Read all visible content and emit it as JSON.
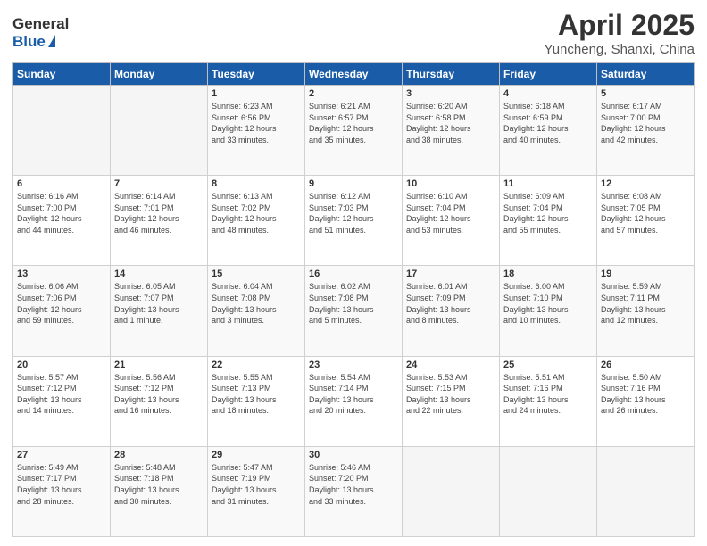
{
  "header": {
    "logo_general": "General",
    "logo_blue": "Blue",
    "title": "April 2025",
    "subtitle": "Yuncheng, Shanxi, China"
  },
  "calendar": {
    "days_of_week": [
      "Sunday",
      "Monday",
      "Tuesday",
      "Wednesday",
      "Thursday",
      "Friday",
      "Saturday"
    ],
    "weeks": [
      [
        {
          "day": "",
          "info": ""
        },
        {
          "day": "",
          "info": ""
        },
        {
          "day": "1",
          "info": "Sunrise: 6:23 AM\nSunset: 6:56 PM\nDaylight: 12 hours\nand 33 minutes."
        },
        {
          "day": "2",
          "info": "Sunrise: 6:21 AM\nSunset: 6:57 PM\nDaylight: 12 hours\nand 35 minutes."
        },
        {
          "day": "3",
          "info": "Sunrise: 6:20 AM\nSunset: 6:58 PM\nDaylight: 12 hours\nand 38 minutes."
        },
        {
          "day": "4",
          "info": "Sunrise: 6:18 AM\nSunset: 6:59 PM\nDaylight: 12 hours\nand 40 minutes."
        },
        {
          "day": "5",
          "info": "Sunrise: 6:17 AM\nSunset: 7:00 PM\nDaylight: 12 hours\nand 42 minutes."
        }
      ],
      [
        {
          "day": "6",
          "info": "Sunrise: 6:16 AM\nSunset: 7:00 PM\nDaylight: 12 hours\nand 44 minutes."
        },
        {
          "day": "7",
          "info": "Sunrise: 6:14 AM\nSunset: 7:01 PM\nDaylight: 12 hours\nand 46 minutes."
        },
        {
          "day": "8",
          "info": "Sunrise: 6:13 AM\nSunset: 7:02 PM\nDaylight: 12 hours\nand 48 minutes."
        },
        {
          "day": "9",
          "info": "Sunrise: 6:12 AM\nSunset: 7:03 PM\nDaylight: 12 hours\nand 51 minutes."
        },
        {
          "day": "10",
          "info": "Sunrise: 6:10 AM\nSunset: 7:04 PM\nDaylight: 12 hours\nand 53 minutes."
        },
        {
          "day": "11",
          "info": "Sunrise: 6:09 AM\nSunset: 7:04 PM\nDaylight: 12 hours\nand 55 minutes."
        },
        {
          "day": "12",
          "info": "Sunrise: 6:08 AM\nSunset: 7:05 PM\nDaylight: 12 hours\nand 57 minutes."
        }
      ],
      [
        {
          "day": "13",
          "info": "Sunrise: 6:06 AM\nSunset: 7:06 PM\nDaylight: 12 hours\nand 59 minutes."
        },
        {
          "day": "14",
          "info": "Sunrise: 6:05 AM\nSunset: 7:07 PM\nDaylight: 13 hours\nand 1 minute."
        },
        {
          "day": "15",
          "info": "Sunrise: 6:04 AM\nSunset: 7:08 PM\nDaylight: 13 hours\nand 3 minutes."
        },
        {
          "day": "16",
          "info": "Sunrise: 6:02 AM\nSunset: 7:08 PM\nDaylight: 13 hours\nand 5 minutes."
        },
        {
          "day": "17",
          "info": "Sunrise: 6:01 AM\nSunset: 7:09 PM\nDaylight: 13 hours\nand 8 minutes."
        },
        {
          "day": "18",
          "info": "Sunrise: 6:00 AM\nSunset: 7:10 PM\nDaylight: 13 hours\nand 10 minutes."
        },
        {
          "day": "19",
          "info": "Sunrise: 5:59 AM\nSunset: 7:11 PM\nDaylight: 13 hours\nand 12 minutes."
        }
      ],
      [
        {
          "day": "20",
          "info": "Sunrise: 5:57 AM\nSunset: 7:12 PM\nDaylight: 13 hours\nand 14 minutes."
        },
        {
          "day": "21",
          "info": "Sunrise: 5:56 AM\nSunset: 7:12 PM\nDaylight: 13 hours\nand 16 minutes."
        },
        {
          "day": "22",
          "info": "Sunrise: 5:55 AM\nSunset: 7:13 PM\nDaylight: 13 hours\nand 18 minutes."
        },
        {
          "day": "23",
          "info": "Sunrise: 5:54 AM\nSunset: 7:14 PM\nDaylight: 13 hours\nand 20 minutes."
        },
        {
          "day": "24",
          "info": "Sunrise: 5:53 AM\nSunset: 7:15 PM\nDaylight: 13 hours\nand 22 minutes."
        },
        {
          "day": "25",
          "info": "Sunrise: 5:51 AM\nSunset: 7:16 PM\nDaylight: 13 hours\nand 24 minutes."
        },
        {
          "day": "26",
          "info": "Sunrise: 5:50 AM\nSunset: 7:16 PM\nDaylight: 13 hours\nand 26 minutes."
        }
      ],
      [
        {
          "day": "27",
          "info": "Sunrise: 5:49 AM\nSunset: 7:17 PM\nDaylight: 13 hours\nand 28 minutes."
        },
        {
          "day": "28",
          "info": "Sunrise: 5:48 AM\nSunset: 7:18 PM\nDaylight: 13 hours\nand 30 minutes."
        },
        {
          "day": "29",
          "info": "Sunrise: 5:47 AM\nSunset: 7:19 PM\nDaylight: 13 hours\nand 31 minutes."
        },
        {
          "day": "30",
          "info": "Sunrise: 5:46 AM\nSunset: 7:20 PM\nDaylight: 13 hours\nand 33 minutes."
        },
        {
          "day": "",
          "info": ""
        },
        {
          "day": "",
          "info": ""
        },
        {
          "day": "",
          "info": ""
        }
      ]
    ]
  }
}
